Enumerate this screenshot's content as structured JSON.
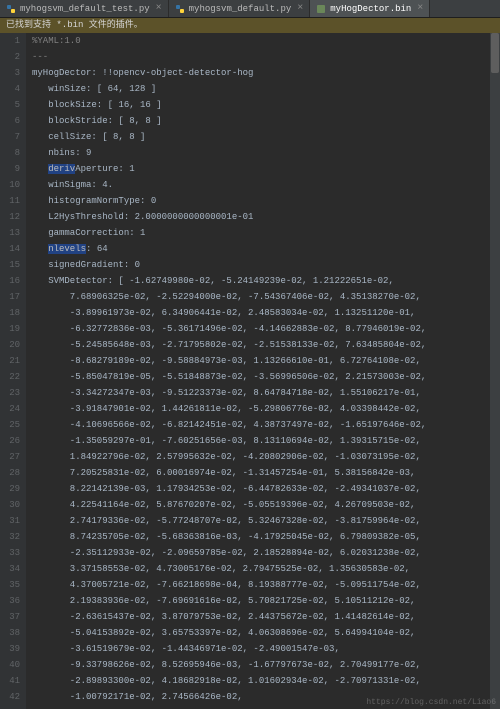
{
  "tabs": [
    {
      "label": "myhogsvm_default_test.py",
      "icon": "py"
    },
    {
      "label": "myhogsvm_default.py",
      "icon": "py"
    },
    {
      "label": "myHogDector.bin",
      "icon": "bin",
      "active": true
    }
  ],
  "notice": "已找到支持 *.bin 文件的插件。",
  "watermark": "https://blog.csdn.net/Liao6",
  "lines": [
    {
      "n": 1,
      "t": "%YAML:1.0",
      "cls": "cmt"
    },
    {
      "n": 2,
      "t": "---",
      "cls": "cmt"
    },
    {
      "n": 3,
      "t": "myHogDector: !!opencv-object-detector-hog"
    },
    {
      "n": 4,
      "t": "   winSize: [ 64, 128 ]"
    },
    {
      "n": 5,
      "t": "   blockSize: [ 16, 16 ]"
    },
    {
      "n": 6,
      "t": "   blockStride: [ 8, 8 ]"
    },
    {
      "n": 7,
      "t": "   cellSize: [ 8, 8 ]"
    },
    {
      "n": 8,
      "t": "   nbins: 9"
    },
    {
      "n": 9,
      "t": "   derivAperture: 1",
      "hiStart": 3,
      "hiLen": 5
    },
    {
      "n": 10,
      "t": "   winSigma: 4."
    },
    {
      "n": 11,
      "t": "   histogramNormType: 0"
    },
    {
      "n": 12,
      "t": "   L2HysThreshold: 2.0000000000000001e-01"
    },
    {
      "n": 13,
      "t": "   gammaCorrection: 1"
    },
    {
      "n": 14,
      "t": "   nlevels: 64",
      "hiStart": 3,
      "hiLen": 7
    },
    {
      "n": 15,
      "t": "   signedGradient: 0"
    },
    {
      "n": 16,
      "t": "   SVMDetector: [ -1.62749980e-02, -5.24149239e-02, 1.21222651e-02,"
    },
    {
      "n": 17,
      "t": "       7.68906325e-02, -2.52294000e-02, -7.54367406e-02, 4.35138270e-02,"
    },
    {
      "n": 18,
      "t": "       -3.89961973e-02, 6.34906441e-02, 2.48583034e-02, 1.13251120e-01,"
    },
    {
      "n": 19,
      "t": "       -6.32772836e-03, -5.36171496e-02, -4.14662883e-02, 8.77946019e-02,"
    },
    {
      "n": 20,
      "t": "       -5.24585648e-03, -2.71795802e-02, -2.51538133e-02, 7.63485804e-02,"
    },
    {
      "n": 21,
      "t": "       -8.68279189e-02, -9.58884973e-03, 1.13266610e-01, 6.72764108e-02,"
    },
    {
      "n": 22,
      "t": "       -5.85047819e-05, -5.51848873e-02, -3.56996506e-02, 2.21573003e-02,"
    },
    {
      "n": 23,
      "t": "       -3.34272347e-03, -9.51223373e-02, 8.64784718e-02, 1.55106217e-01,"
    },
    {
      "n": 24,
      "t": "       -3.91847901e-02, 1.44261811e-02, -5.29806776e-02, 4.03398442e-02,"
    },
    {
      "n": 25,
      "t": "       -4.10696566e-02, -6.82142451e-02, 4.38737497e-02, -1.65197646e-02,"
    },
    {
      "n": 26,
      "t": "       -1.35059297e-01, -7.60251656e-03, 8.13110694e-02, 1.39315715e-02,"
    },
    {
      "n": 27,
      "t": "       1.84922796e-02, 2.57995632e-02, -4.20802906e-02, -1.03073195e-02,"
    },
    {
      "n": 28,
      "t": "       7.20525831e-02, 6.00016974e-02, -1.31457254e-01, 5.38156842e-03,"
    },
    {
      "n": 29,
      "t": "       8.22142139e-03, 1.17934253e-02, -6.44782633e-02, -2.49341037e-02,"
    },
    {
      "n": 30,
      "t": "       4.22541164e-02, 5.87670207e-02, -5.05519396e-02, 4.26709503e-02,"
    },
    {
      "n": 31,
      "t": "       2.74179336e-02, -5.77248707e-02, 5.32467328e-02, -3.81759964e-02,"
    },
    {
      "n": 32,
      "t": "       8.74235705e-02, -5.68363816e-03, -4.17925045e-02, 6.79809382e-05,"
    },
    {
      "n": 33,
      "t": "       -2.35112933e-02, -2.09659785e-02, 2.18528894e-02, 6.02031238e-02,"
    },
    {
      "n": 34,
      "t": "       3.37158553e-02, 4.73005176e-02, 2.79475525e-02, 1.35630583e-02,"
    },
    {
      "n": 35,
      "t": "       4.37005721e-02, -7.66218698e-04, 8.19388777e-02, -5.09511754e-02,"
    },
    {
      "n": 36,
      "t": "       2.19383936e-02, -7.69691616e-02, 5.70821725e-02, 5.10511212e-02,"
    },
    {
      "n": 37,
      "t": "       -2.63615437e-02, 3.87079753e-02, 2.44375672e-02, 1.41482614e-02,"
    },
    {
      "n": 38,
      "t": "       -5.04153892e-02, 3.65753397e-02, 4.06308696e-02, 5.64994104e-02,"
    },
    {
      "n": 39,
      "t": "       -3.61519679e-02, -1.44346971e-02, -2.49001547e-03,"
    },
    {
      "n": 40,
      "t": "       -9.33798626e-02, 8.52695946e-03, -1.67797673e-02, 2.70499177e-02,"
    },
    {
      "n": 41,
      "t": "       -2.89893300e-02, 4.18682918e-02, 1.01602934e-02, -2.70971331e-02,"
    },
    {
      "n": 42,
      "t": "       -1.00792171e-02, 2.74566426e-02,"
    }
  ]
}
